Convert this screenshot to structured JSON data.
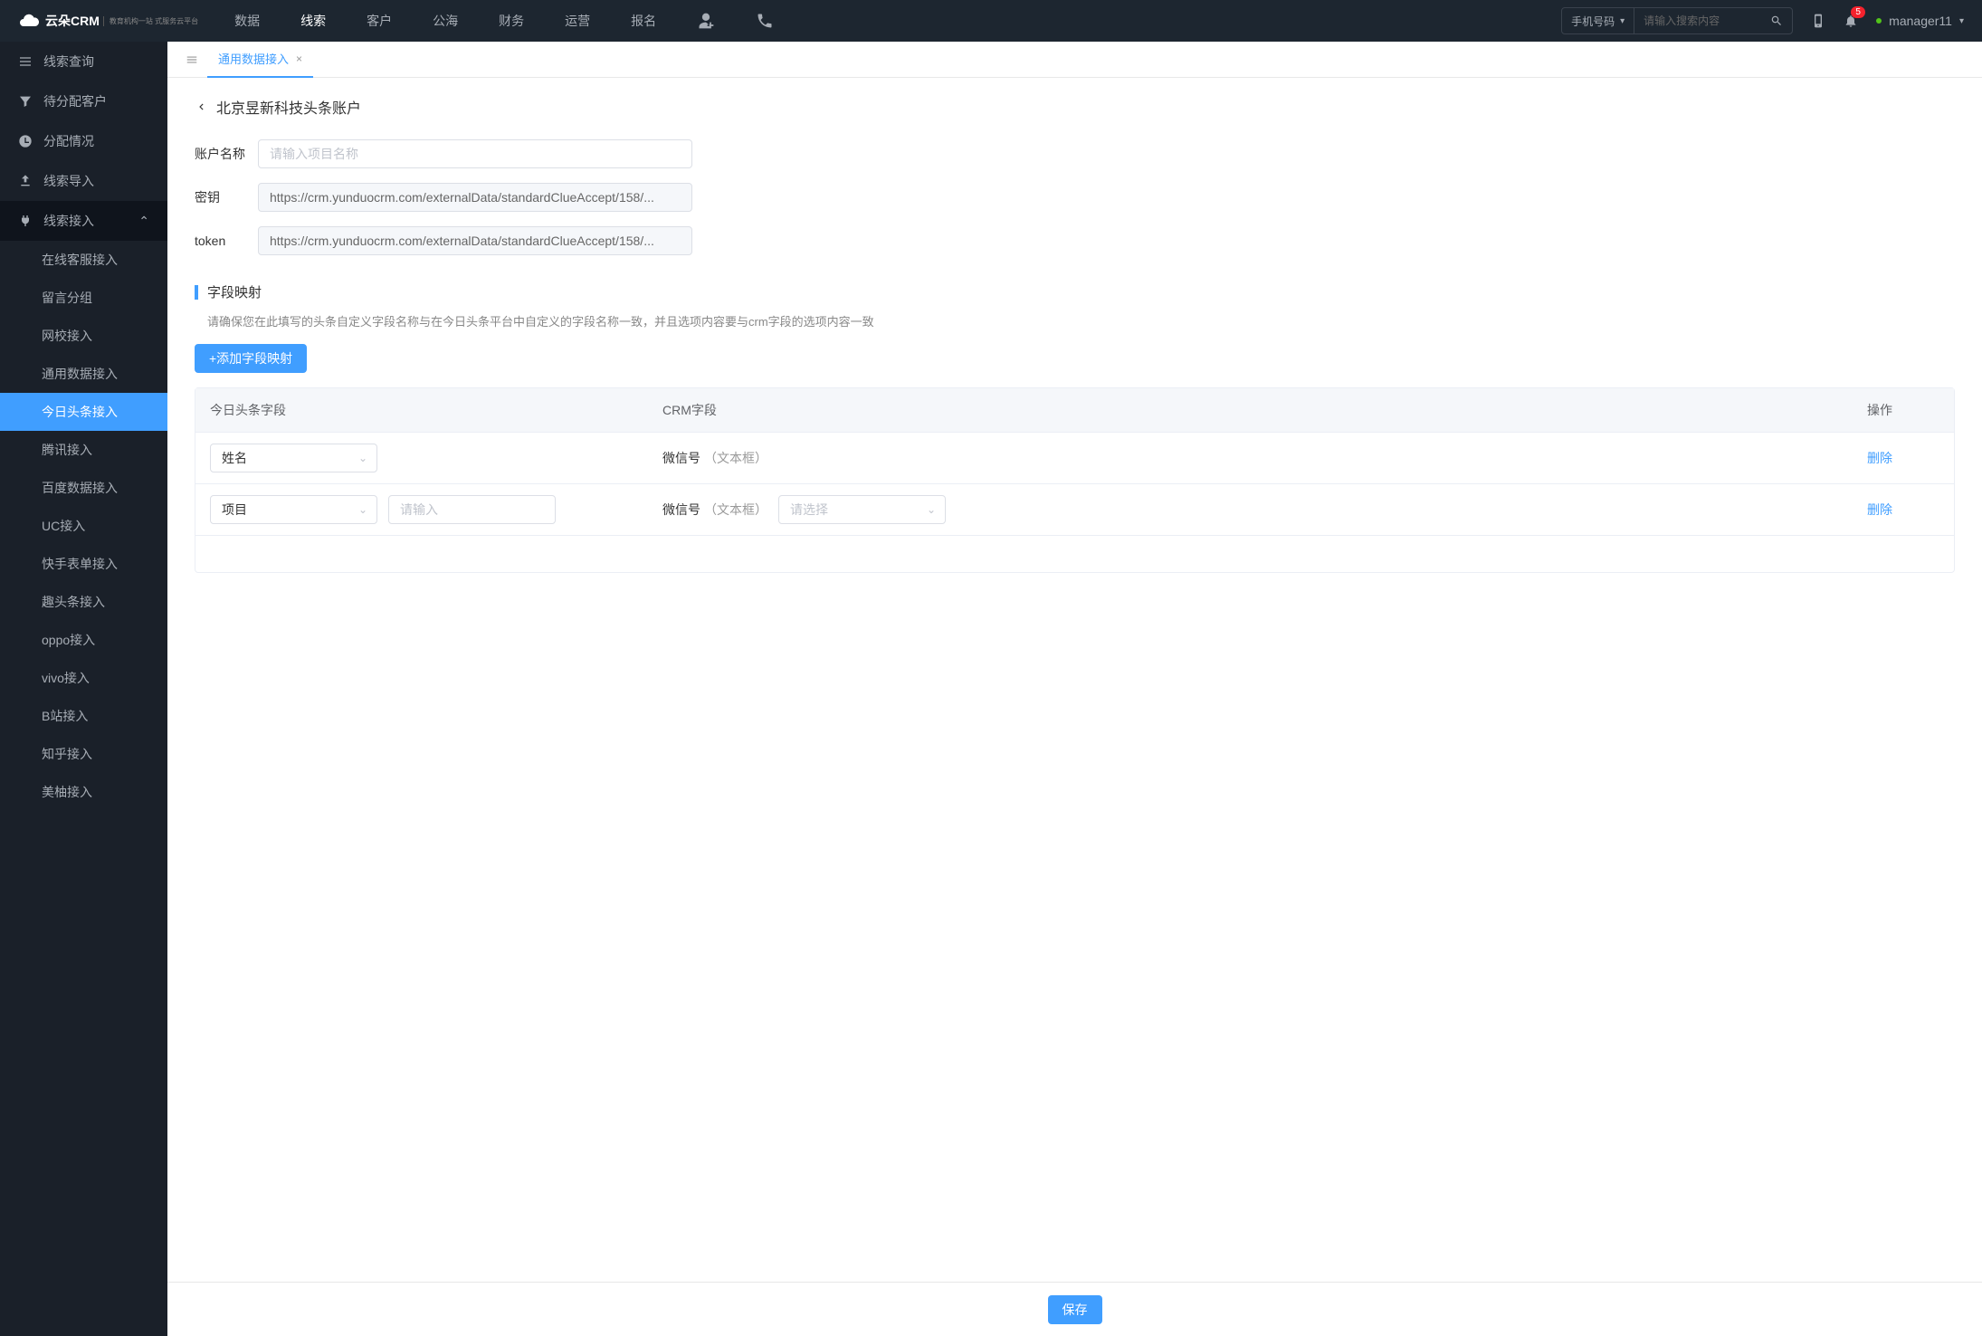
{
  "header": {
    "logo_main": "云朵CRM",
    "logo_sub": "教育机构一站\n式服务云平台",
    "nav": [
      "数据",
      "线索",
      "客户",
      "公海",
      "财务",
      "运营",
      "报名"
    ],
    "active_nav": "线索",
    "search_type": "手机号码",
    "search_placeholder": "请输入搜索内容",
    "badge_count": "5",
    "username": "manager11"
  },
  "sidebar": {
    "items": [
      {
        "label": "线索查询",
        "icon": "list"
      },
      {
        "label": "待分配客户",
        "icon": "filter"
      },
      {
        "label": "分配情况",
        "icon": "clock"
      },
      {
        "label": "线索导入",
        "icon": "import"
      },
      {
        "label": "线索接入",
        "icon": "plug",
        "expanded": true,
        "children": [
          "在线客服接入",
          "留言分组",
          "网校接入",
          "通用数据接入",
          "今日头条接入",
          "腾讯接入",
          "百度数据接入",
          "UC接入",
          "快手表单接入",
          "趣头条接入",
          "oppo接入",
          "vivo接入",
          "B站接入",
          "知乎接入",
          "美柚接入"
        ],
        "active_child": "今日头条接入"
      }
    ]
  },
  "tabs": {
    "items": [
      {
        "label": "通用数据接入"
      }
    ],
    "active": "通用数据接入"
  },
  "page": {
    "title": "北京昱新科技头条账户",
    "form": {
      "account_name_label": "账户名称",
      "account_name_placeholder": "请输入项目名称",
      "secret_label": "密钥",
      "secret_value": "https://crm.yunduocrm.com/externalData/standardClueAccept/158/...",
      "token_label": "token",
      "token_value": "https://crm.yunduocrm.com/externalData/standardClueAccept/158/..."
    },
    "mapping": {
      "section_title": "字段映射",
      "hint": "请确保您在此填写的头条自定义字段名称与在今日头条平台中自定义的字段名称一致，并且选项内容要与crm字段的选项内容一致",
      "add_button": "+添加字段映射",
      "columns": {
        "c1": "今日头条字段",
        "c2": "CRM字段",
        "c3": "操作"
      },
      "rows": [
        {
          "toutiao_field": "姓名",
          "extra_input": null,
          "crm_field": "微信号",
          "crm_type": "（文本框）",
          "crm_select": null,
          "action": "删除"
        },
        {
          "toutiao_field": "项目",
          "extra_input_placeholder": "请输入",
          "crm_field": "微信号",
          "crm_type": "（文本框）",
          "crm_select_placeholder": "请选择",
          "action": "删除"
        }
      ]
    },
    "save_button": "保存"
  }
}
